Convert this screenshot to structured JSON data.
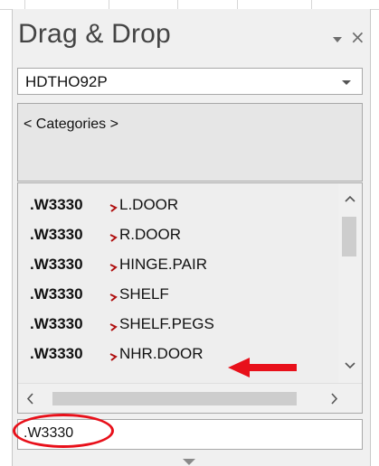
{
  "panel": {
    "title": "Drag & Drop",
    "menu_icon": "chevron-down-icon",
    "close_icon": "close-icon",
    "close_glyph": "×"
  },
  "library_combo": {
    "value": "HDTHO92P"
  },
  "categories": {
    "label": "< Categories >"
  },
  "parts_list": {
    "items": [
      {
        "code": ".W3330",
        "name": "L.DOOR"
      },
      {
        "code": ".W3330",
        "name": "R.DOOR"
      },
      {
        "code": ".W3330",
        "name": "HINGE.PAIR"
      },
      {
        "code": ".W3330",
        "name": "SHELF"
      },
      {
        "code": ".W3330",
        "name": "SHELF.PEGS"
      },
      {
        "code": ".W3330",
        "name": "NHR.DOOR"
      }
    ],
    "marker_color": "#b01010"
  },
  "filter_input": {
    "value": ".W3330"
  },
  "annotations": {
    "color": "#e8101a",
    "arrow_target": "NHR.DOOR",
    "circle_target": "filter-input"
  }
}
